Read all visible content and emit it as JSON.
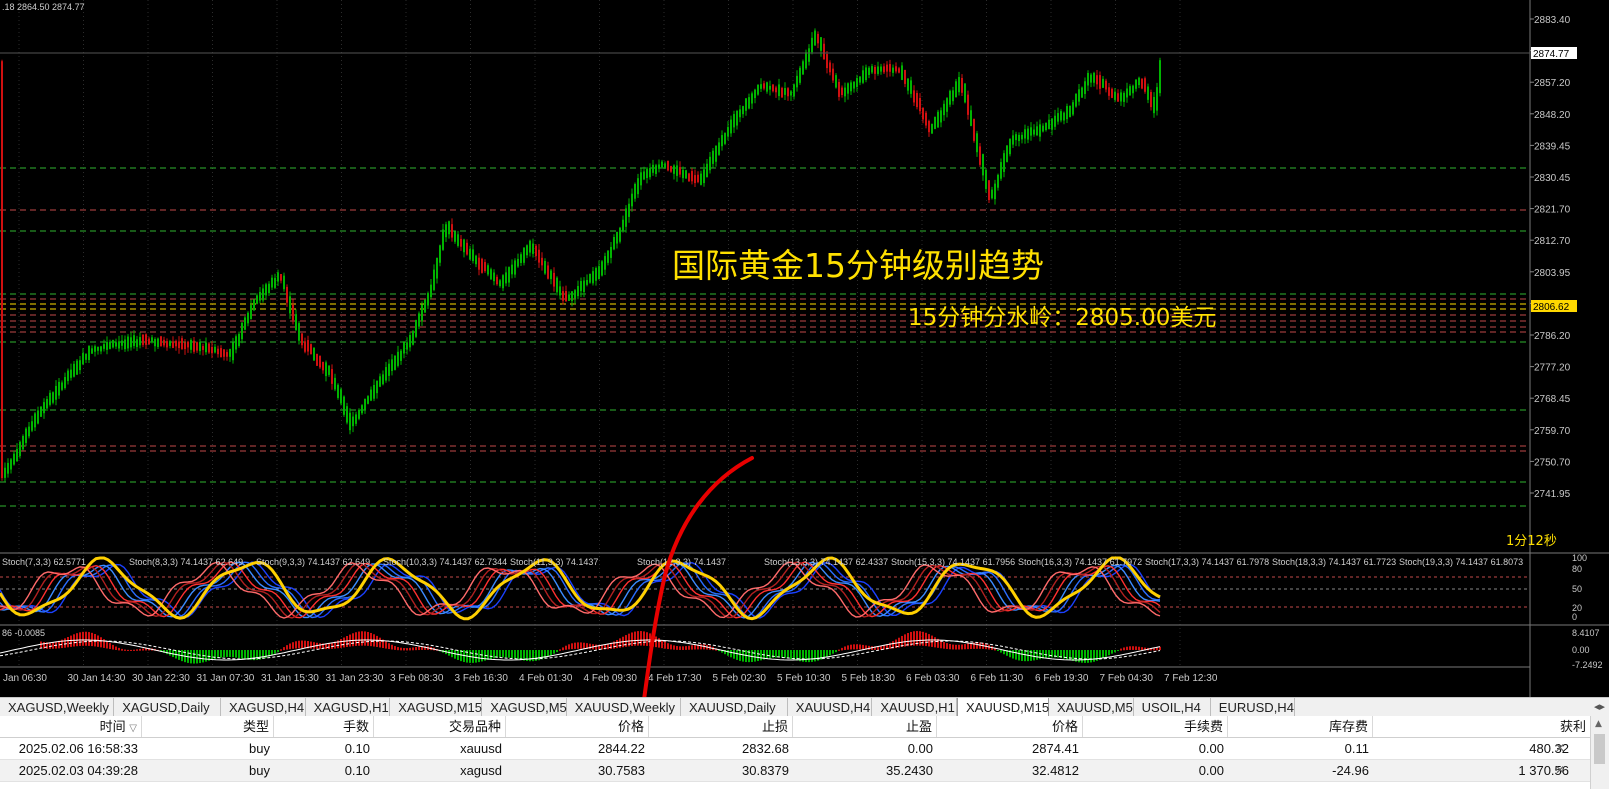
{
  "chart": {
    "symbol_header": ".18 2864.50 2874.77",
    "annotation_title": "国际黄金15分钟级别趋势",
    "annotation_sub": "15分钟分水岭：2805.00美元",
    "timer": "1分12秒",
    "price_labels": [
      "2883.40",
      "2865.95",
      "2857.20",
      "2848.20",
      "2839.45",
      "2830.45",
      "2821.70",
      "2812.70",
      "2803.95",
      "2794.95",
      "2786.20",
      "2777.20",
      "2768.45",
      "2759.70",
      "2750.70",
      "2741.95"
    ],
    "current_price": "2874.77",
    "level_price": "2806.62",
    "time_labels": [
      "Jan 06:30",
      "30 Jan 14:30",
      "30 Jan 22:30",
      "31 Jan 07:30",
      "31 Jan 15:30",
      "31 Jan 23:30",
      "3 Feb 08:30",
      "3 Feb 16:30",
      "4 Feb 01:30",
      "4 Feb 09:30",
      "4 Feb 17:30",
      "5 Feb 02:30",
      "5 Feb 10:30",
      "5 Feb 18:30",
      "6 Feb 03:30",
      "6 Feb 11:30",
      "6 Feb 19:30",
      "7 Feb 04:30",
      "7 Feb 12:30"
    ],
    "stoch_labels": [
      "Stoch(7,3,3) 62.5771",
      "Stoch(8,3,3) 74.1437 62.649",
      "Stoch(9,3,3) 74.1437 62.649",
      "Stoch(10,3,3) 74.1437 62.7344",
      "Stoch(11,3,3) 74.1437",
      "Stoch(12,3,3) 74.1437",
      "Stoch(13,3,3) 74.1437 62.4337",
      "Stoch(15,3,3) 74.1437 61.7956",
      "Stoch(16,3,3) 74.1437 61.7972",
      "Stoch(17,3,3) 74.1437 61.7978",
      "Stoch(18,3,3) 74.1437 61.7723",
      "Stoch(19,3,3) 74.1437 61.8073"
    ],
    "stoch_axis": [
      "100",
      "80",
      "50",
      "20",
      "0"
    ],
    "macd_label": "86 -0.0085",
    "macd_axis": [
      "8.4107",
      "0.00",
      "-7.2492"
    ]
  },
  "tabs": [
    "XAGUSD,Weekly",
    "XAGUSD,Daily",
    "XAGUSD,H4",
    "XAGUSD,H1",
    "XAGUSD,M15",
    "XAGUSD,M5",
    "XAUUSD,Weekly",
    "XAUUSD,Daily",
    "XAUUSD,H4",
    "XAUUSD,H1",
    "XAUUSD,M15",
    "XAUUSD,M5",
    "USOIL,H4",
    "EURUSD,H4"
  ],
  "active_tab": "XAUUSD,M15",
  "table": {
    "headers": [
      "时间",
      "类型",
      "手数",
      "交易品种",
      "价格",
      "止损",
      "止盈",
      "价格",
      "手续费",
      "库存费",
      "获利"
    ],
    "rows": [
      [
        "2025.02.06 16:58:33",
        "buy",
        "0.10",
        "xauusd",
        "2844.22",
        "2832.68",
        "0.00",
        "2874.41",
        "0.00",
        "0.11",
        "480.32"
      ],
      [
        "2025.02.03 04:39:28",
        "buy",
        "0.10",
        "xagusd",
        "30.7583",
        "30.8379",
        "35.2430",
        "32.4812",
        "0.00",
        "-24.96",
        "1 370.56"
      ]
    ]
  },
  "colors": {
    "bull": "#00b400",
    "bear": "#d01010",
    "annotation": "#ffe000",
    "pen": "#e80000",
    "stoch_main": "#ffd000"
  }
}
